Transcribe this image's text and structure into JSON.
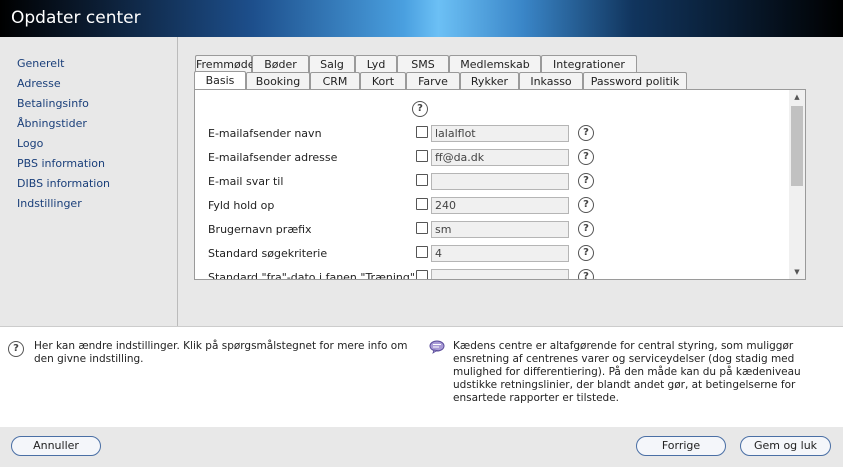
{
  "window": {
    "title": "Opdater center"
  },
  "sidebar": {
    "items": [
      {
        "label": "Generelt"
      },
      {
        "label": "Adresse"
      },
      {
        "label": "Betalingsinfo"
      },
      {
        "label": "Åbningstider"
      },
      {
        "label": "Logo"
      },
      {
        "label": "PBS information"
      },
      {
        "label": "DIBS information"
      },
      {
        "label": "Indstillinger"
      }
    ]
  },
  "tabs": {
    "row1": [
      "Fremmøde",
      "Bøder",
      "Salg",
      "Lyd",
      "SMS",
      "Medlemskab",
      "Integrationer"
    ],
    "row2": [
      "Basis",
      "Booking",
      "CRM",
      "Kort",
      "Farve",
      "Rykker",
      "Inkasso",
      "Password politik"
    ],
    "active": "Basis"
  },
  "form": {
    "rows": [
      {
        "label": "E-mailafsender navn",
        "value": "lalalflot"
      },
      {
        "label": "E-mailafsender adresse",
        "value": "ff@da.dk"
      },
      {
        "label": "E-mail svar til",
        "value": ""
      },
      {
        "label": "Fyld hold op",
        "value": "240"
      },
      {
        "label": "Brugernavn præfix",
        "value": "sm"
      },
      {
        "label": "Standard søgekriterie",
        "value": "4"
      },
      {
        "label": "Standard \"fra\"-dato i fanen \"Træning\"",
        "value": ""
      }
    ]
  },
  "info": {
    "hint": "Her kan ændre indstillinger. Klik på spørgsmålstegnet for mere info om den givne indstilling.",
    "description": "Kædens centre er altafgørende for central styring, som muliggør ensretning af centrenes varer og serviceydelser (dog stadig med mulighed for differentiering). På den måde kan du på kædeniveau udstikke retningslinier, der blandt andet gør, at betingelserne for ensartede rapporter er tilstede."
  },
  "footer": {
    "cancel": "Annuller",
    "previous": "Forrige",
    "save": "Gem og luk"
  }
}
